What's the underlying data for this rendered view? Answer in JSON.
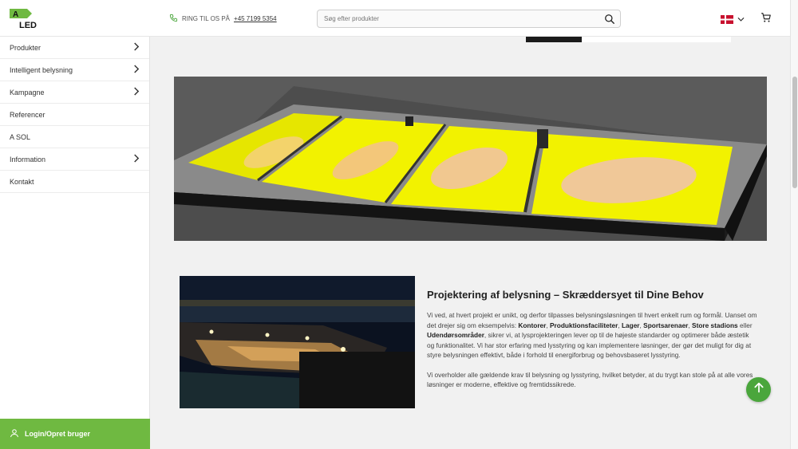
{
  "header": {
    "logo_top": "A",
    "logo_bottom": "LED",
    "phone_label": "RING TIL OS PÅ",
    "phone_number": "+45 7199 5354",
    "search_placeholder": "Søg efter produkter"
  },
  "sidebar": {
    "items": [
      {
        "label": "Produkter",
        "has_submenu": true
      },
      {
        "label": "Intelligent belysning",
        "has_submenu": true
      },
      {
        "label": "Kampagne",
        "has_submenu": true
      },
      {
        "label": "Referencer",
        "has_submenu": false
      },
      {
        "label": "A SOL",
        "has_submenu": false
      },
      {
        "label": "Information",
        "has_submenu": true
      },
      {
        "label": "Kontakt",
        "has_submenu": false
      }
    ],
    "login_label": "Login/Opret bruger"
  },
  "content": {
    "heading": "Projektering af belysning – Skræddersyet til Dine Behov",
    "para1": {
      "t1": "Vi ved, at hvert projekt er unikt, og derfor tilpasses belysningsløsningen til hvert enkelt rum og formål. Uanset om det drejer sig om eksempelvis: ",
      "b1": "Kontorer",
      "s1": ", ",
      "b2": "Produktionsfaciliteter",
      "s2": ", ",
      "b3": "Lager",
      "s3": ", ",
      "b4": "Sportsarenaer",
      "s4": ", ",
      "b5": "Store stadions",
      "s5": " eller ",
      "b6": "Udendørsområder",
      "t2": ", sikrer vi, at lysprojekteringen lever op til de højeste standarder og optimerer både æstetik og funktionalitet. Vi har stor erfaring med lysstyring og kan implementere løsninger, der gør det muligt for dig at styre belysningen effektivt, både i forhold til energiforbrug og behovsbaseret lysstyring."
    },
    "para2": "Vi overholder alle gældende krav til belysning og lysstyring, hvilket betyder, at du trygt kan stole på at alle vores løsninger er moderne, effektive og fremtidssikrede."
  },
  "colors": {
    "brand_green": "#6fb941",
    "fab_green": "#4aa63c",
    "heatmap_yellow": "#f2f200"
  },
  "icons": {
    "phone": "phone-icon",
    "search": "search-icon",
    "flag": "denmark-flag-icon",
    "chevron": "chevron-down-icon",
    "cart": "cart-icon",
    "user": "user-icon",
    "scroll_top": "arrow-up-icon"
  }
}
